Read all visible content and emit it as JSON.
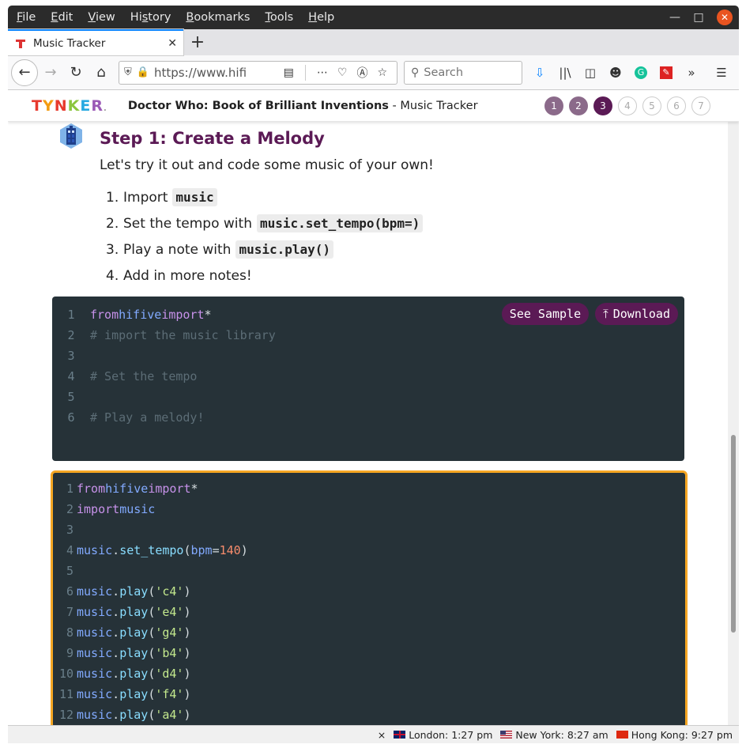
{
  "menu": [
    "File",
    "Edit",
    "View",
    "History",
    "Bookmarks",
    "Tools",
    "Help"
  ],
  "menu_underline": [
    "F",
    "E",
    "V",
    "s",
    "B",
    "T",
    "H"
  ],
  "tab": {
    "title": "Music Tracker"
  },
  "nav": {
    "url": "https://www.hifi",
    "search_placeholder": "Search"
  },
  "site": {
    "logo": "TYNKER",
    "title_bold": "Doctor Who: Book of Brilliant Inventions",
    "title_rest": " - Music Tracker",
    "steps": [
      "1",
      "2",
      "3",
      "4",
      "5",
      "6",
      "7"
    ],
    "current_step": 3
  },
  "content": {
    "step_title": "Step 1: Create a Melody",
    "intro": "Let's try it out and code some music of your own!",
    "instructions": [
      {
        "num": "1.",
        "text": "Import",
        "code": "music"
      },
      {
        "num": "2.",
        "text": "Set the tempo with",
        "code": "music.set_tempo(bpm=)"
      },
      {
        "num": "3.",
        "text": "Play a note with",
        "code": "music.play()"
      },
      {
        "num": "4.",
        "text": "Add in more notes!",
        "code": ""
      }
    ]
  },
  "editor1": {
    "buttons": {
      "sample": "See Sample",
      "download": "Download"
    },
    "line_numbers": [
      "1",
      "2",
      "3",
      "4",
      "5",
      "6"
    ],
    "lines": {
      "l1": {
        "kw1": "from",
        "mod": "hifive",
        "kw2": "import",
        "op": "*"
      },
      "l2": "# import the music library",
      "l4": "# Set the tempo",
      "l6": "# Play a melody!"
    }
  },
  "editor2": {
    "line_numbers": [
      "1",
      "2",
      "3",
      "4",
      "5",
      "6",
      "7",
      "8",
      "9",
      "10",
      "11",
      "12"
    ],
    "l1": {
      "kw1": "from",
      "mod": "hifive",
      "kw2": "import",
      "op": "*"
    },
    "l2": {
      "kw": "import",
      "mod": "music"
    },
    "tempo": {
      "obj": "music",
      "dot": ".",
      "fn": "set_tempo",
      "open": "(",
      "kwarg": "bpm",
      "eq": "=",
      "num": "140",
      "close": ")"
    },
    "play_obj": "music",
    "play_fn": "play",
    "notes": [
      "'c4'",
      "'e4'",
      "'g4'",
      "'b4'",
      "'d4'",
      "'f4'",
      "'a4'"
    ]
  },
  "status": {
    "close": "×",
    "clocks": [
      "London: 1:27 pm",
      "New York: 8:27 am",
      "Hong Kong: 9:27 pm"
    ]
  },
  "colors": {
    "accent": "#5b1a55",
    "highlight": "#f5a623",
    "editor_bg": "#263238"
  }
}
